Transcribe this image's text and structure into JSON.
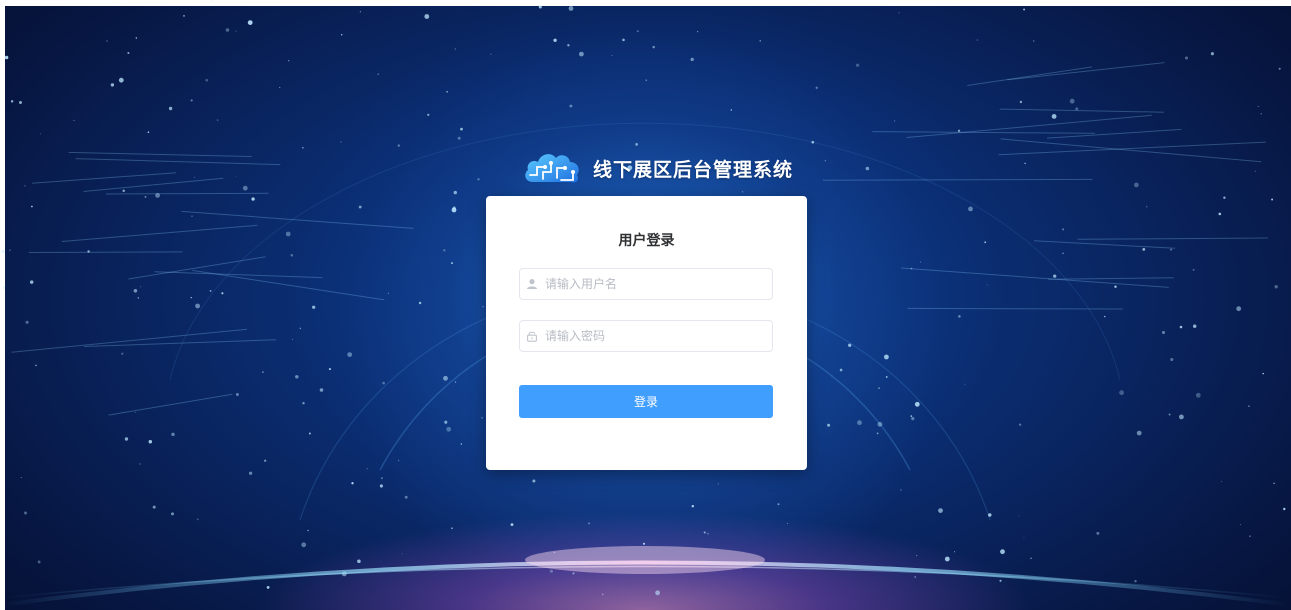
{
  "brand": {
    "title": "线下展区后台管理系统",
    "logo_icon": "cloud-circuit-icon"
  },
  "login": {
    "title": "用户登录",
    "username_placeholder": "请输入用户名",
    "username_value": "",
    "username_icon": "user-icon",
    "password_placeholder": "请输入密码",
    "password_value": "",
    "password_icon": "lock-icon",
    "submit_label": "登录"
  },
  "colors": {
    "primary": "#409eff",
    "background": "#0a2a6b",
    "card": "#ffffff"
  }
}
